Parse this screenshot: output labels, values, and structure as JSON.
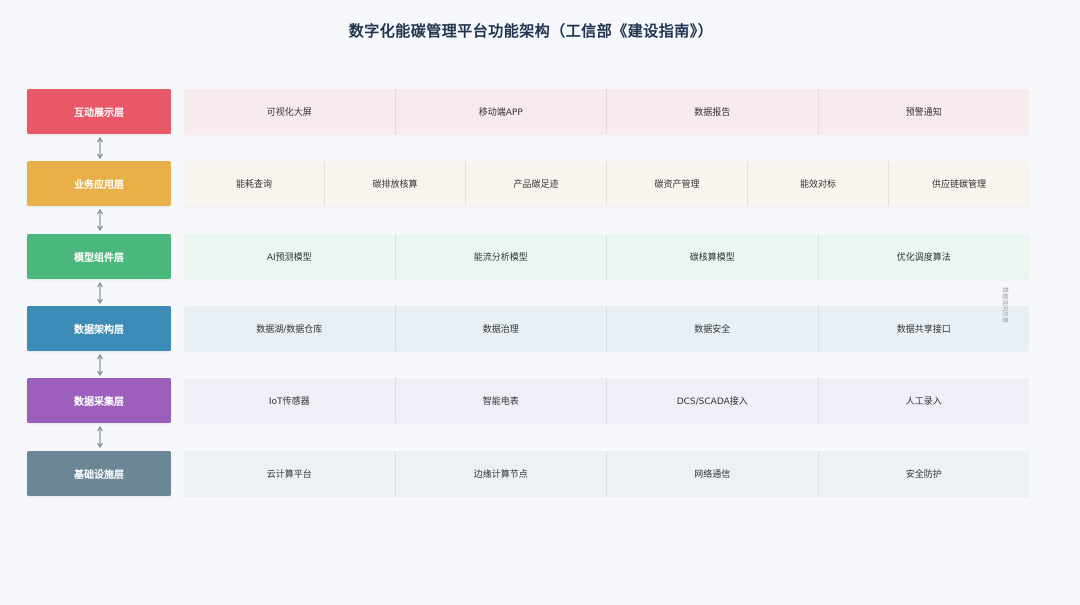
{
  "title": "数字化能碳管理平台功能架构（工信部《建设指南》）",
  "side_note": "数据流向示意",
  "layers": [
    {
      "label": "互动展示层",
      "color": "#e85866",
      "row_bg": "#f8ebee",
      "items": [
        "可视化大屏",
        "移动端APP",
        "数据报告",
        "预警通知"
      ]
    },
    {
      "label": "业务应用层",
      "color": "#e8b048",
      "row_bg": "#f8f5ee",
      "items": [
        "能耗查询",
        "碳排放核算",
        "产品碳足迹",
        "碳资产管理",
        "能效对标",
        "供应链碳管理"
      ]
    },
    {
      "label": "模型组件层",
      "color": "#4bb77c",
      "row_bg": "#ebf6f1",
      "items": [
        "AI预测模型",
        "能流分析模型",
        "碳核算模型",
        "优化调度算法"
      ]
    },
    {
      "label": "数据架构层",
      "color": "#3d8cb7",
      "row_bg": "#e8f0f6",
      "items": [
        "数据湖/数据仓库",
        "数据治理",
        "数据安全",
        "数据共享接口"
      ]
    },
    {
      "label": "数据采集层",
      "color": "#9c5fbb",
      "row_bg": "#f2eef8",
      "items": [
        "IoT传感器",
        "智能电表",
        "DCS/SCADA接入",
        "人工录入"
      ]
    },
    {
      "label": "基础设施层",
      "color": "#6b8696",
      "row_bg": "#edf1f3",
      "items": [
        "云计算平台",
        "边缘计算节点",
        "网络通信",
        "安全防护"
      ]
    }
  ]
}
